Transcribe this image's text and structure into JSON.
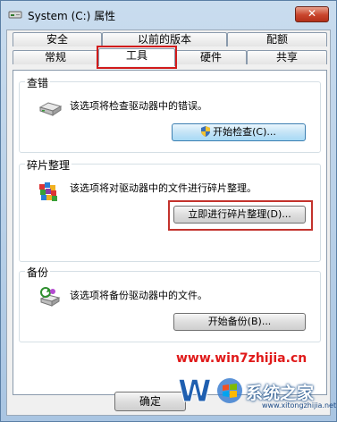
{
  "window": {
    "title": "System (C:) 属性",
    "close_label": "✕"
  },
  "tabs": {
    "row_top": [
      "安全",
      "以前的版本",
      "配额"
    ],
    "row_bottom": [
      "常规",
      "工具",
      "硬件",
      "共享"
    ],
    "active": "工具"
  },
  "groups": {
    "check": {
      "title": "查错",
      "description": "该选项将检查驱动器中的错误。",
      "button": "开始检查(C)..."
    },
    "defrag": {
      "title": "碎片整理",
      "description": "该选项将对驱动器中的文件进行碎片整理。",
      "button": "立即进行碎片整理(D)..."
    },
    "backup": {
      "title": "备份",
      "description": "该选项将备份驱动器中的文件。",
      "button": "开始备份(B)..."
    }
  },
  "footer": {
    "ok_label": "确定"
  },
  "watermark": {
    "url": "www.win7zhijia.cn",
    "brand": "系统之家",
    "sub": "www.xitongzhijia.net"
  },
  "colors": {
    "highlight": "#d11b1b",
    "title_gradient": "#c9dcee",
    "panel_bg": "#ffffff"
  }
}
